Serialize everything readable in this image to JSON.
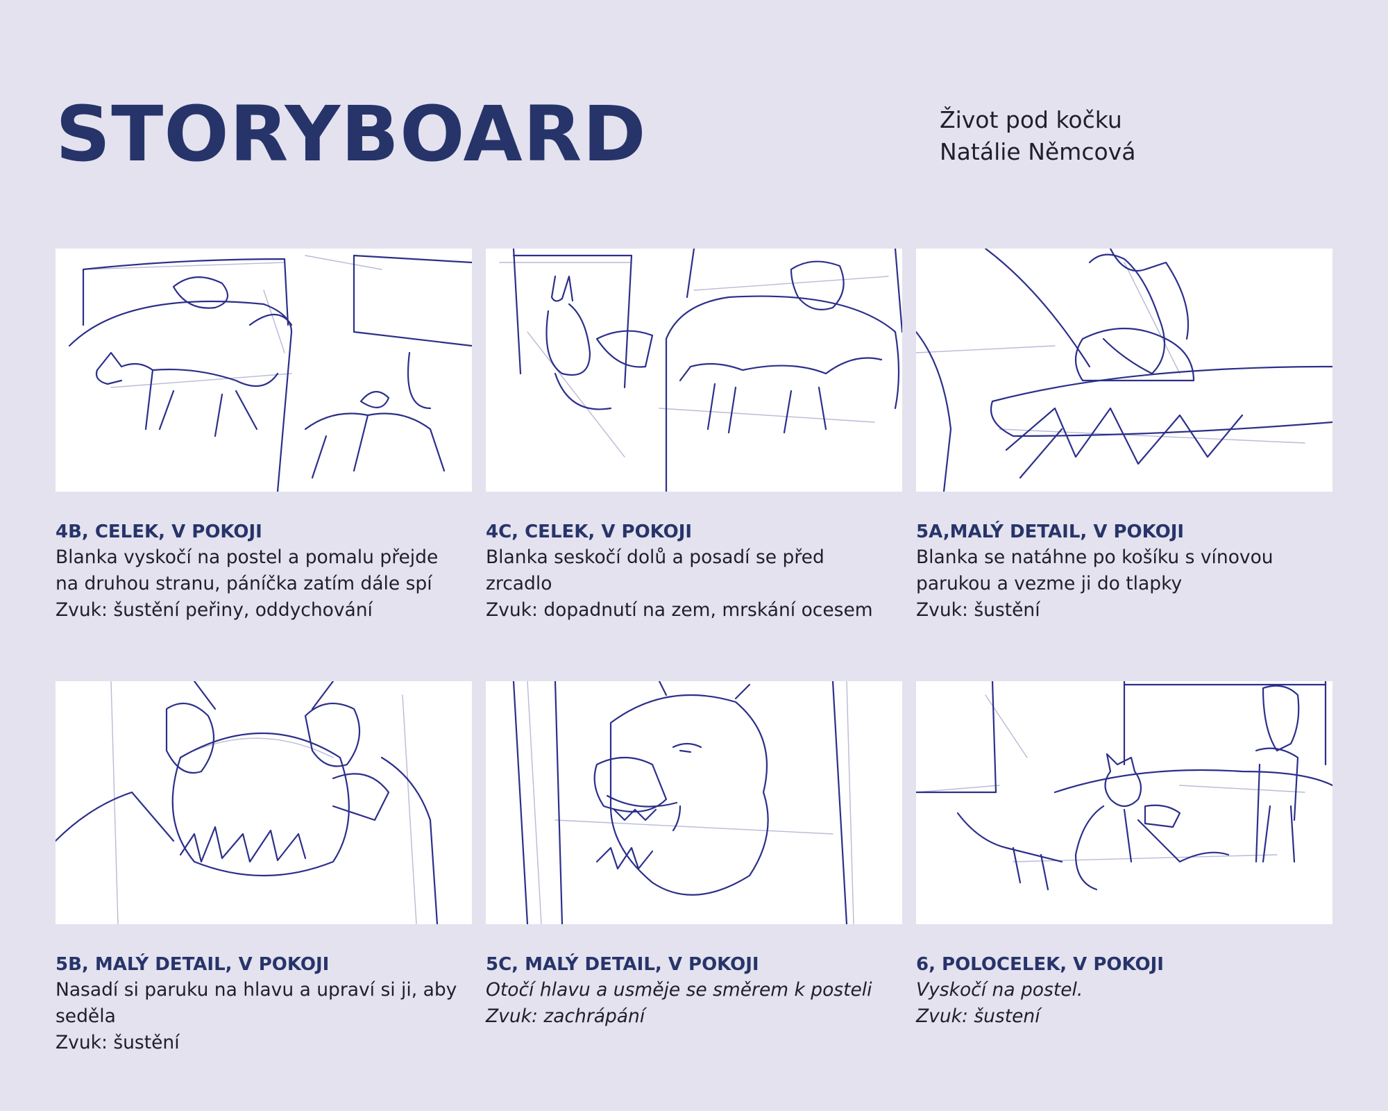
{
  "header": {
    "title": "STORYBOARD",
    "film_title": "Život pod kočku",
    "author": "Natálie Němcová"
  },
  "panels": [
    {
      "shot": "4B, CELEK, V POKOJI",
      "lines": [
        "Blanka vyskočí na postel a pomalu přejde",
        "na druhou stranu, páníčka zatím dále spí",
        "Zvuk: šustění peřiny, oddychování"
      ],
      "italic": false,
      "sketch": "cat walking across bed, person sleeping, second cat climbing"
    },
    {
      "shot": "4C, CELEK, V POKOJI",
      "lines": [
        "Blanka seskočí dolů a posadí se před",
        "zrcadlo",
        "Zvuk: dopadnutí na zem, mrskání ocesem"
      ],
      "italic": false,
      "sketch": "cat sitting before mirror, person in bed, cat walking"
    },
    {
      "shot": "5A,MALÝ DETAIL, V POKOJI",
      "lines": [
        "Blanka se natáhne po košíku s vínovou",
        "parukou a vezme ji do tlapky",
        "Zvuk: šustění"
      ],
      "italic": false,
      "sketch": "paw reaching into basket with wig"
    },
    {
      "shot": "5B, MALÝ DETAIL, V POKOJI",
      "lines": [
        "Nasadí si paruku na hlavu a upraví si ji, aby",
        "seděla",
        "Zvuk: šustění"
      ],
      "italic": false,
      "sketch": "cat putting wig on head from behind"
    },
    {
      "shot": "5C, MALÝ DETAIL, V POKOJI",
      "lines": [
        "Otočí hlavu a usměje se směrem k posteli",
        "Zvuk: zachrápání"
      ],
      "italic": true,
      "sketch": "cat face with wig smiling"
    },
    {
      "shot": "6, POLOCELEK, V POKOJI",
      "lines": [
        "Vyskočí na postel.",
        "Zvuk: šustení"
      ],
      "italic": true,
      "sketch": "cat jumping on bed next to standing cat"
    }
  ]
}
